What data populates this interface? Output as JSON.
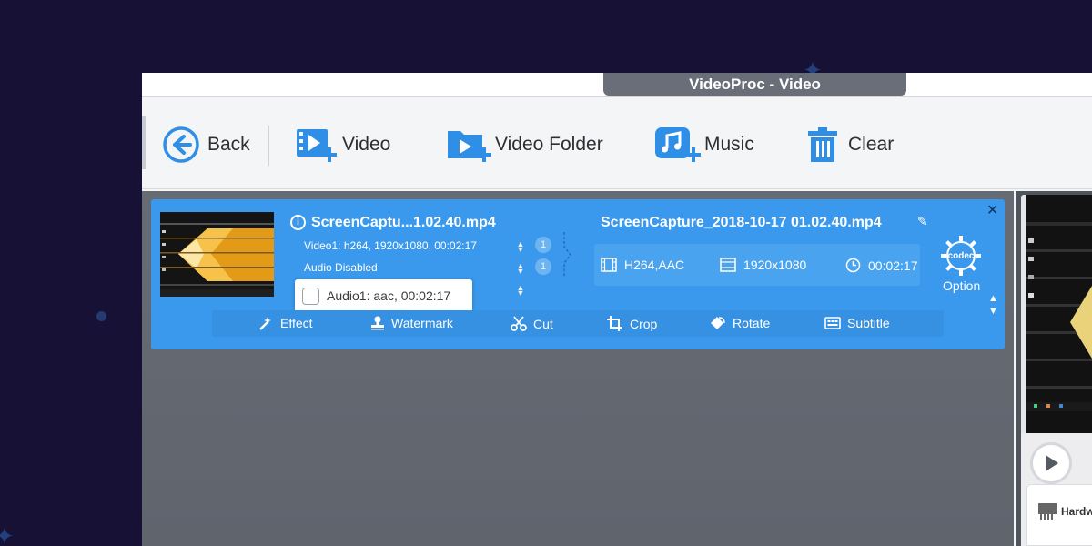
{
  "window": {
    "title": "VideoProc - Video"
  },
  "toolbar": {
    "back_label": "Back",
    "video_label": "Video",
    "video_folder_label": "Video Folder",
    "music_label": "Music",
    "clear_label": "Clear"
  },
  "source": {
    "title": "ScreenCaptu...1.02.40.mp4",
    "video_track": "Video1: h264, 1920x1080, 00:02:17",
    "video_track_count": "1",
    "audio_status": "Audio Disabled",
    "audio_track_count": "1",
    "audio_option": "Audio1: aac, 00:02:17"
  },
  "output": {
    "title": "ScreenCapture_2018-10-17 01.02.40.mp4",
    "codec": "H264,AAC",
    "resolution": "1920x1080",
    "duration": "00:02:17",
    "codec_icon_text": "codec",
    "option_label": "Option"
  },
  "edit": {
    "effect": "Effect",
    "watermark": "Watermark",
    "cut": "Cut",
    "crop": "Crop",
    "rotate": "Rotate",
    "subtitle": "Subtitle"
  },
  "preview": {
    "hardware_label": "Hardw"
  },
  "colors": {
    "accent": "#3a99ec",
    "icon_blue": "#2f8fe6",
    "background": "#161135"
  }
}
